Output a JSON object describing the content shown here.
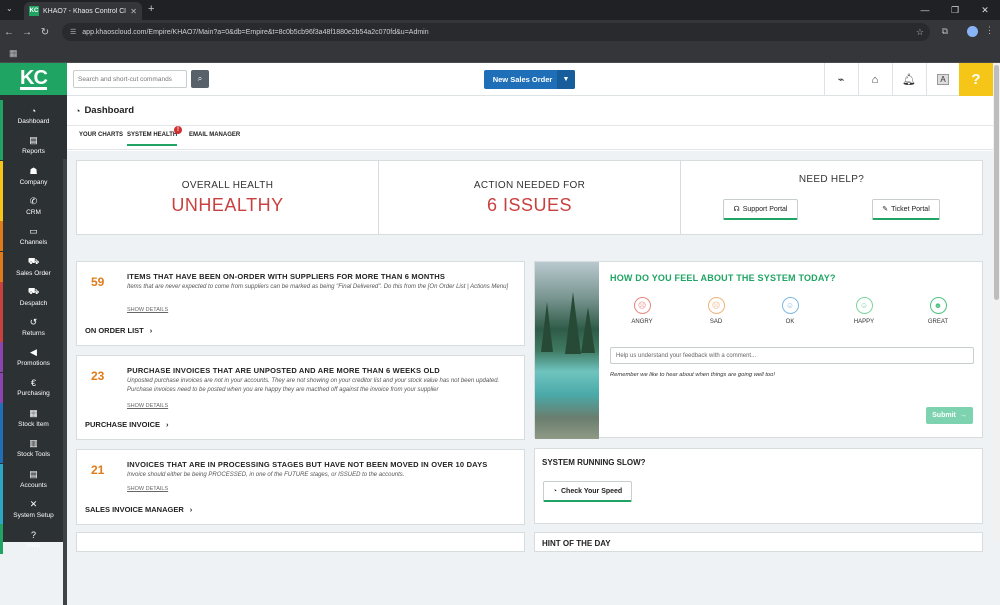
{
  "browser": {
    "tab_title": "KHAO7 - Khaos Control Cloud",
    "tab_favicon": "KC",
    "url": "app.khaoscloud.com/Empire/KHAO7/Main?a=0&db=Empire&t=8c0b5cb96f3a48f1880e2b54a2c070fd&u=Admin"
  },
  "logo": "KC",
  "sidebar": {
    "items": [
      {
        "label": "Dashboard",
        "icon": "gauge-icon",
        "glyph": "◔"
      },
      {
        "label": "Reports",
        "icon": "report-icon",
        "glyph": "▤"
      },
      {
        "label": "Company",
        "icon": "company-icon",
        "glyph": "☗"
      },
      {
        "label": "CRM",
        "icon": "phone-icon",
        "glyph": "✆"
      },
      {
        "label": "Channels",
        "icon": "channels-icon",
        "glyph": "▭"
      },
      {
        "label": "Sales Order",
        "icon": "cart-icon",
        "glyph": "⛟"
      },
      {
        "label": "Despatch",
        "icon": "truck-icon",
        "glyph": "⛟"
      },
      {
        "label": "Returns",
        "icon": "returns-icon",
        "glyph": "↺"
      },
      {
        "label": "Promotions",
        "icon": "megaphone-icon",
        "glyph": "◀"
      },
      {
        "label": "Purchasing",
        "icon": "purchasing-icon",
        "glyph": "€"
      },
      {
        "label": "Stock Item",
        "icon": "stock-item-icon",
        "glyph": "▦"
      },
      {
        "label": "Stock Tools",
        "icon": "stock-tools-icon",
        "glyph": "▥"
      },
      {
        "label": "Accounts",
        "icon": "accounts-icon",
        "glyph": "▤"
      },
      {
        "label": "System Setup",
        "icon": "tools-icon",
        "glyph": "✕"
      },
      {
        "label": "Help",
        "icon": "help-icon",
        "glyph": "?"
      }
    ],
    "stripe_colors": [
      "#1fa463",
      "#f5c518",
      "#e07b1a",
      "#c9413f",
      "#8e44ad",
      "#1e6fb8",
      "#2aa8c4",
      "#1fa463"
    ]
  },
  "topbar": {
    "search_placeholder": "Search and short-cut commands",
    "new_sales_order": "New Sales Order",
    "text_size_glyph": "A",
    "help_glyph": "?"
  },
  "page": {
    "title": "Dashboard",
    "tabs": [
      {
        "label": "YOUR CHARTS",
        "active": false
      },
      {
        "label": "SYSTEM HEALTH",
        "active": true
      },
      {
        "label": "EMAIL MANAGER",
        "active": false
      }
    ],
    "alert_badge": "!"
  },
  "health": {
    "overall_label": "OVERALL HEALTH",
    "overall_value": "UNHEALTHY",
    "action_label": "ACTION NEEDED FOR",
    "action_value": "6 ISSUES",
    "help_label": "NEED HELP?",
    "support_portal": "Support Portal",
    "ticket_portal": "Ticket Portal"
  },
  "issues": [
    {
      "count": "59",
      "title": "ITEMS THAT HAVE BEEN ON-ORDER WITH SUPPLIERS FOR MORE THAN 6 MONTHS",
      "desc": "Items that are never expected to come from suppliers can be marked as being \"Final Delivered\". Do this from the [On Order List | Actions Menu]",
      "show_details": "SHOW DETAILS",
      "link": "ON ORDER LIST"
    },
    {
      "count": "23",
      "title": "PURCHASE INVOICES THAT ARE UNPOSTED AND ARE MORE THAN 6 WEEKS OLD",
      "desc": "Unposted purchase invoices are not in your accounts. They are not showing on your creditor list and your stock value has not been updated. Purchase invoices need to be posted when you are happy they are macthed off against the invoice from your supplier",
      "show_details": "SHOW DETAILS",
      "link": "PURCHASE INVOICE"
    },
    {
      "count": "21",
      "title": "INVOICES THAT ARE IN PROCESSING STAGES BUT HAVE NOT BEEN MOVED IN OVER 10 DAYS",
      "desc": "Invoice should either be being PROCESSED, in one of the FUTURE stages, or ISSUED to the accounts.",
      "show_details": "SHOW DETAILS",
      "link": "SALES INVOICE MANAGER"
    }
  ],
  "feedback": {
    "title": "HOW DO YOU FEEL ABOUT THE SYSTEM TODAY?",
    "faces": [
      {
        "label": "ANGRY",
        "color": "#e8867e",
        "glyph": "☹"
      },
      {
        "label": "SAD",
        "color": "#f0b27a",
        "glyph": "☹"
      },
      {
        "label": "OK",
        "color": "#7fb8e0",
        "glyph": "☺"
      },
      {
        "label": "HAPPY",
        "color": "#7dd3a0",
        "glyph": "☺"
      },
      {
        "label": "GREAT",
        "color": "#4cc27e",
        "glyph": "☻"
      }
    ],
    "placeholder": "Help us understand your feedback with a comment...",
    "note": "Remember we like to hear about when things are going well too!",
    "submit": "Submit"
  },
  "slow": {
    "title": "SYSTEM RUNNING SLOW?",
    "button": "Check Your Speed"
  },
  "hint": {
    "title": "HINT OF THE DAY"
  }
}
